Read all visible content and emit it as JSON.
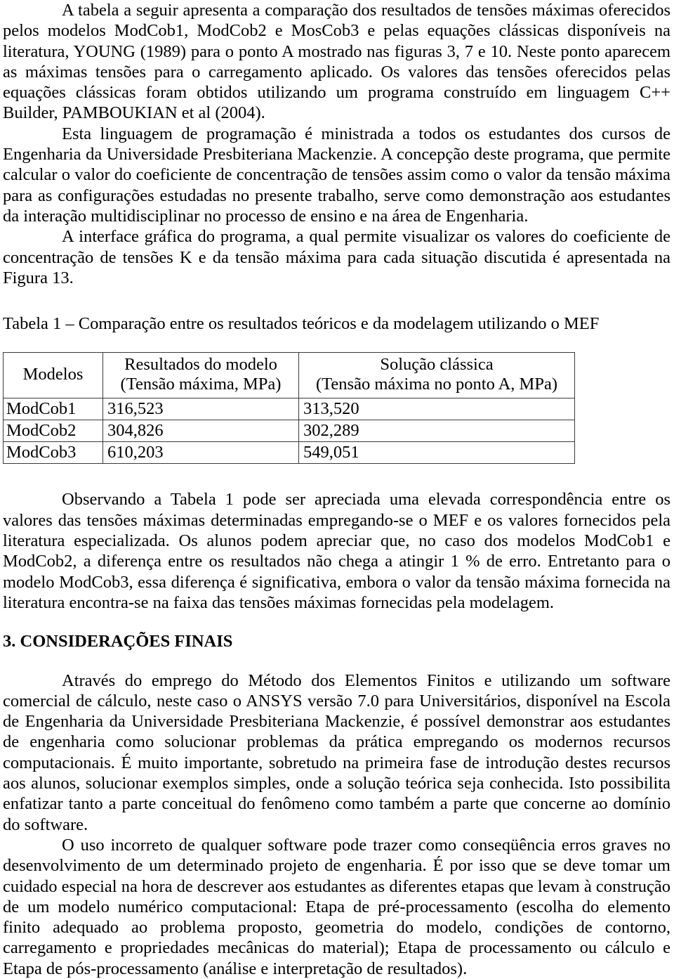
{
  "document": {
    "paragraphs": {
      "p1": "A tabela a seguir apresenta a comparação dos resultados de tensões máximas oferecidos pelos modelos ModCob1, ModCob2 e MosCob3 e pelas equações clássicas disponíveis na literatura, YOUNG (1989) para o ponto A mostrado nas figuras 3, 7 e 10. Neste ponto aparecem as máximas tensões para o carregamento aplicado. Os valores das tensões oferecidos pelas equações clássicas foram obtidos utilizando um programa construído em linguagem C++ Builder, PAMBOUKIAN et al (2004).",
      "p2": "Esta linguagem de programação é ministrada a todos os estudantes dos cursos de Engenharia da Universidade Presbiteriana Mackenzie. A concepção deste programa, que permite calcular o valor do coeficiente de concentração de tensões assim como o valor da tensão máxima para as configurações estudadas no presente trabalho, serve como demonstração aos estudantes da interação multidisciplinar no processo de ensino e na área de Engenharia.",
      "p3": "A interface gráfica do programa, a qual permite visualizar os valores do coeficiente de concentração de tensões K e da tensão máxima para cada situação discutida é apresentada na Figura 13.",
      "p4": "Observando a Tabela 1 pode ser apreciada uma elevada correspondência entre os valores das tensões máximas determinadas empregando-se o MEF e os valores fornecidos pela literatura especializada. Os alunos podem apreciar que, no caso dos modelos ModCob1 e ModCob2, a diferença entre os resultados não chega a atingir 1 % de erro. Entretanto para o modelo ModCob3, essa diferença é significativa, embora o valor da tensão máxima fornecida na literatura encontra-se na faixa das tensões máximas fornecidas pela modelagem.",
      "p5": "Através do emprego do Método dos Elementos Finitos e utilizando um software comercial de cálculo, neste caso o ANSYS versão 7.0 para Universitários, disponível na Escola de Engenharia da Universidade Presbiteriana Mackenzie, é possível demonstrar aos estudantes de engenharia como solucionar problemas da prática empregando os modernos recursos computacionais. É muito importante, sobretudo na primeira fase de introdução destes recursos aos alunos, solucionar exemplos simples, onde a solução teórica seja conhecida. Isto possibilita enfatizar tanto a parte conceitual do fenômeno como também a parte que concerne ao domínio do software.",
      "p6": "O uso incorreto de qualquer software pode trazer como conseqüência erros graves no desenvolvimento de um determinado projeto de engenharia. É por isso que se deve tomar um cuidado especial na hora de descrever aos estudantes as diferentes etapas que levam à construção de um modelo numérico computacional: Etapa de pré-processamento (escolha do elemento finito adequado ao problema proposto, geometria do modelo, condições de contorno, carregamento e propriedades mecânicas do material); Etapa de processamento ou cálculo e Etapa de pós-processamento (análise e interpretação de resultados)."
    },
    "table_caption": "Tabela 1 – Comparação entre os resultados teóricos e da modelagem utilizando o MEF",
    "section_heading": "3. CONSIDERAÇÕES FINAIS",
    "table": {
      "headers": [
        {
          "line1": "Modelos",
          "line2": ""
        },
        {
          "line1": "Resultados do modelo",
          "line2": "(Tensão máxima, MPa)"
        },
        {
          "line1": "Solução clássica",
          "line2": "(Tensão máxima no ponto A, MPa)"
        }
      ],
      "rows": [
        {
          "model": "ModCob1",
          "model_result": "316,523",
          "classic_solution": "313,520"
        },
        {
          "model": "ModCob2",
          "model_result": "304,826",
          "classic_solution": "302,289"
        },
        {
          "model": "ModCob3",
          "model_result": "610,203",
          "classic_solution": "549,051"
        }
      ]
    }
  }
}
